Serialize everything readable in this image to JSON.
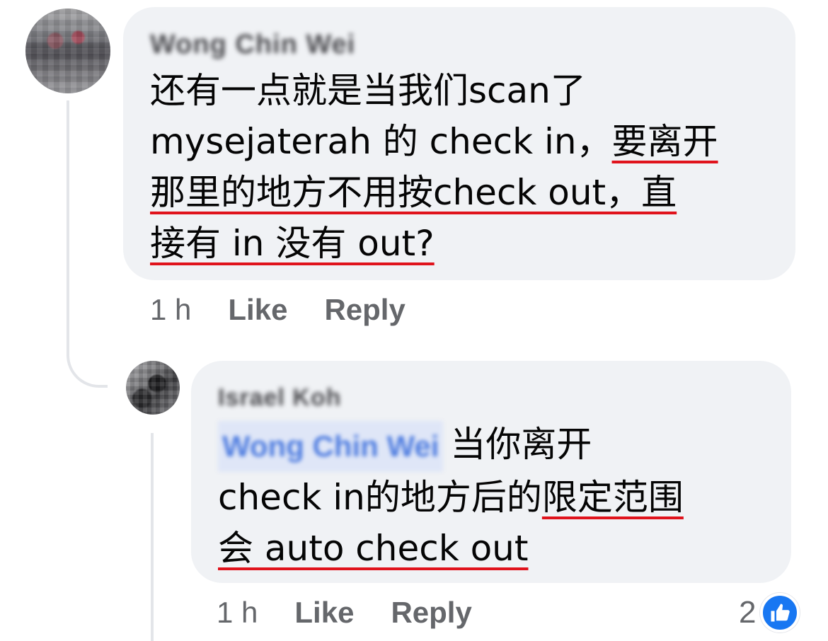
{
  "comments": [
    {
      "author": "Wong Chin Wei",
      "lines": [
        [
          {
            "text": "还有一点就是当我们scan了",
            "u": false
          }
        ],
        [
          {
            "text": "mysejaterah 的 check in，",
            "u": false
          },
          {
            "text": "要离开",
            "u": true
          }
        ],
        [
          {
            "text": "那里的地方不用按check out，直",
            "u": true
          }
        ],
        [
          {
            "text": "接有 in 没有 out?",
            "u": true
          }
        ]
      ],
      "timestamp": "1 h",
      "like_label": "Like",
      "reply_label": "Reply"
    },
    {
      "author": "Israel Koh",
      "mention": "Wong Chin Wei",
      "lines": [
        [
          {
            "text": "当你离开",
            "u": false
          }
        ],
        [
          {
            "text": "check in的地方后的",
            "u": false
          },
          {
            "text": "限定范围",
            "u": true
          }
        ],
        [
          {
            "text": "会 auto check out",
            "u": true
          }
        ]
      ],
      "timestamp": "1 h",
      "like_label": "Like",
      "reply_label": "Reply",
      "reaction_count": "2",
      "reaction_icon": "thumbs-up-icon"
    }
  ],
  "colors": {
    "bubble_bg": "#f0f2f5",
    "underline": "#e0131c",
    "meta_text": "#65676b",
    "like_blue": "#1877f2",
    "mention_blue": "#4f7de0"
  }
}
